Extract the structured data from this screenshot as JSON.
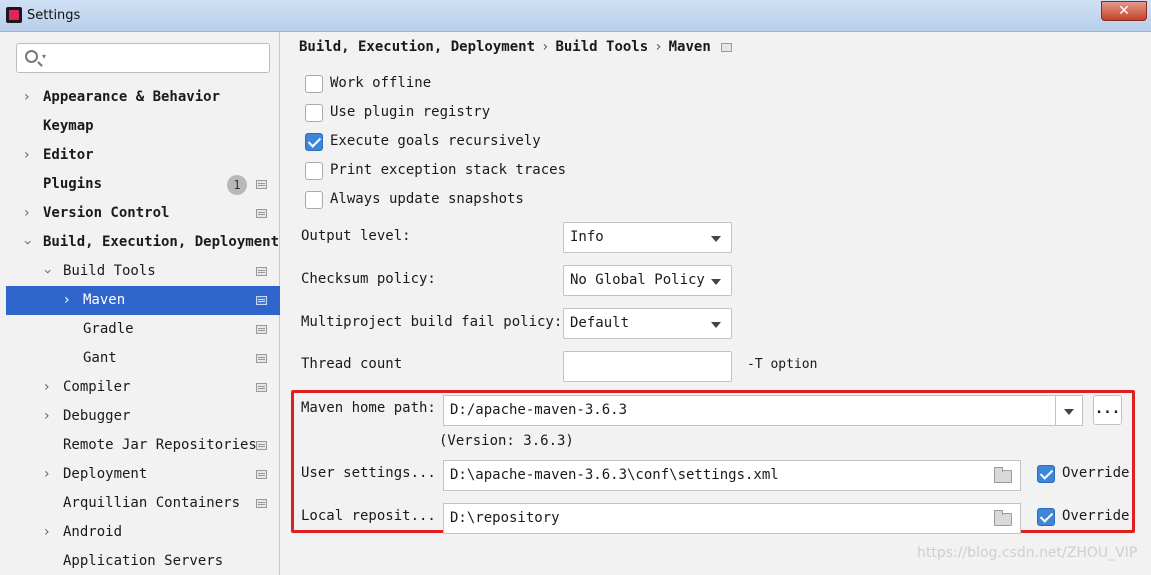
{
  "window": {
    "title": "Settings",
    "close_label": "✕"
  },
  "sidebar": {
    "search_placeholder": "",
    "items": [
      {
        "label": "Appearance & Behavior"
      },
      {
        "label": "Keymap"
      },
      {
        "label": "Editor"
      },
      {
        "label": "Plugins",
        "badge": "1"
      },
      {
        "label": "Version Control"
      },
      {
        "label": "Build, Execution, Deployment"
      },
      {
        "label": "Build Tools"
      },
      {
        "label": "Maven"
      },
      {
        "label": "Gradle"
      },
      {
        "label": "Gant"
      },
      {
        "label": "Compiler"
      },
      {
        "label": "Debugger"
      },
      {
        "label": "Remote Jar Repositories"
      },
      {
        "label": "Deployment"
      },
      {
        "label": "Arquillian Containers"
      },
      {
        "label": "Android"
      },
      {
        "label": "Application Servers"
      }
    ]
  },
  "breadcrumb": [
    "Build, Execution, Deployment",
    "Build Tools",
    "Maven"
  ],
  "options": [
    {
      "label": "Work offline",
      "checked": false
    },
    {
      "label": "Use plugin registry",
      "checked": false
    },
    {
      "label": "Execute goals recursively",
      "checked": true
    },
    {
      "label": "Print exception stack traces",
      "checked": false
    },
    {
      "label": "Always update snapshots",
      "checked": false
    }
  ],
  "fields": {
    "output_level": {
      "label": "Output level:",
      "value": "Info"
    },
    "checksum_policy": {
      "label": "Checksum policy:",
      "value": "No Global Policy"
    },
    "fail_policy": {
      "label": "Multiproject build fail policy:",
      "value": "Default"
    },
    "thread_count": {
      "label": "Thread count",
      "value": "",
      "note": "-T option"
    }
  },
  "maven": {
    "home_label": "Maven home path:",
    "home_value": "D:/apache-maven-3.6.3",
    "browse_label": "...",
    "version_text": "(Version: 3.6.3)",
    "user_settings_label": "User settings...",
    "user_settings_value": "D:\\apache-maven-3.6.3\\conf\\settings.xml",
    "user_override_label": "Override",
    "user_override_checked": true,
    "local_repo_label": "Local reposit...",
    "local_repo_value": "D:\\repository",
    "local_override_label": "Override",
    "local_override_checked": true
  },
  "watermark": "https://blog.csdn.net/ZHOU_VIP",
  "colors": {
    "selection": "#2f65ca",
    "highlight_border": "#e02020",
    "checkbox_checked": "#3d87d9"
  }
}
